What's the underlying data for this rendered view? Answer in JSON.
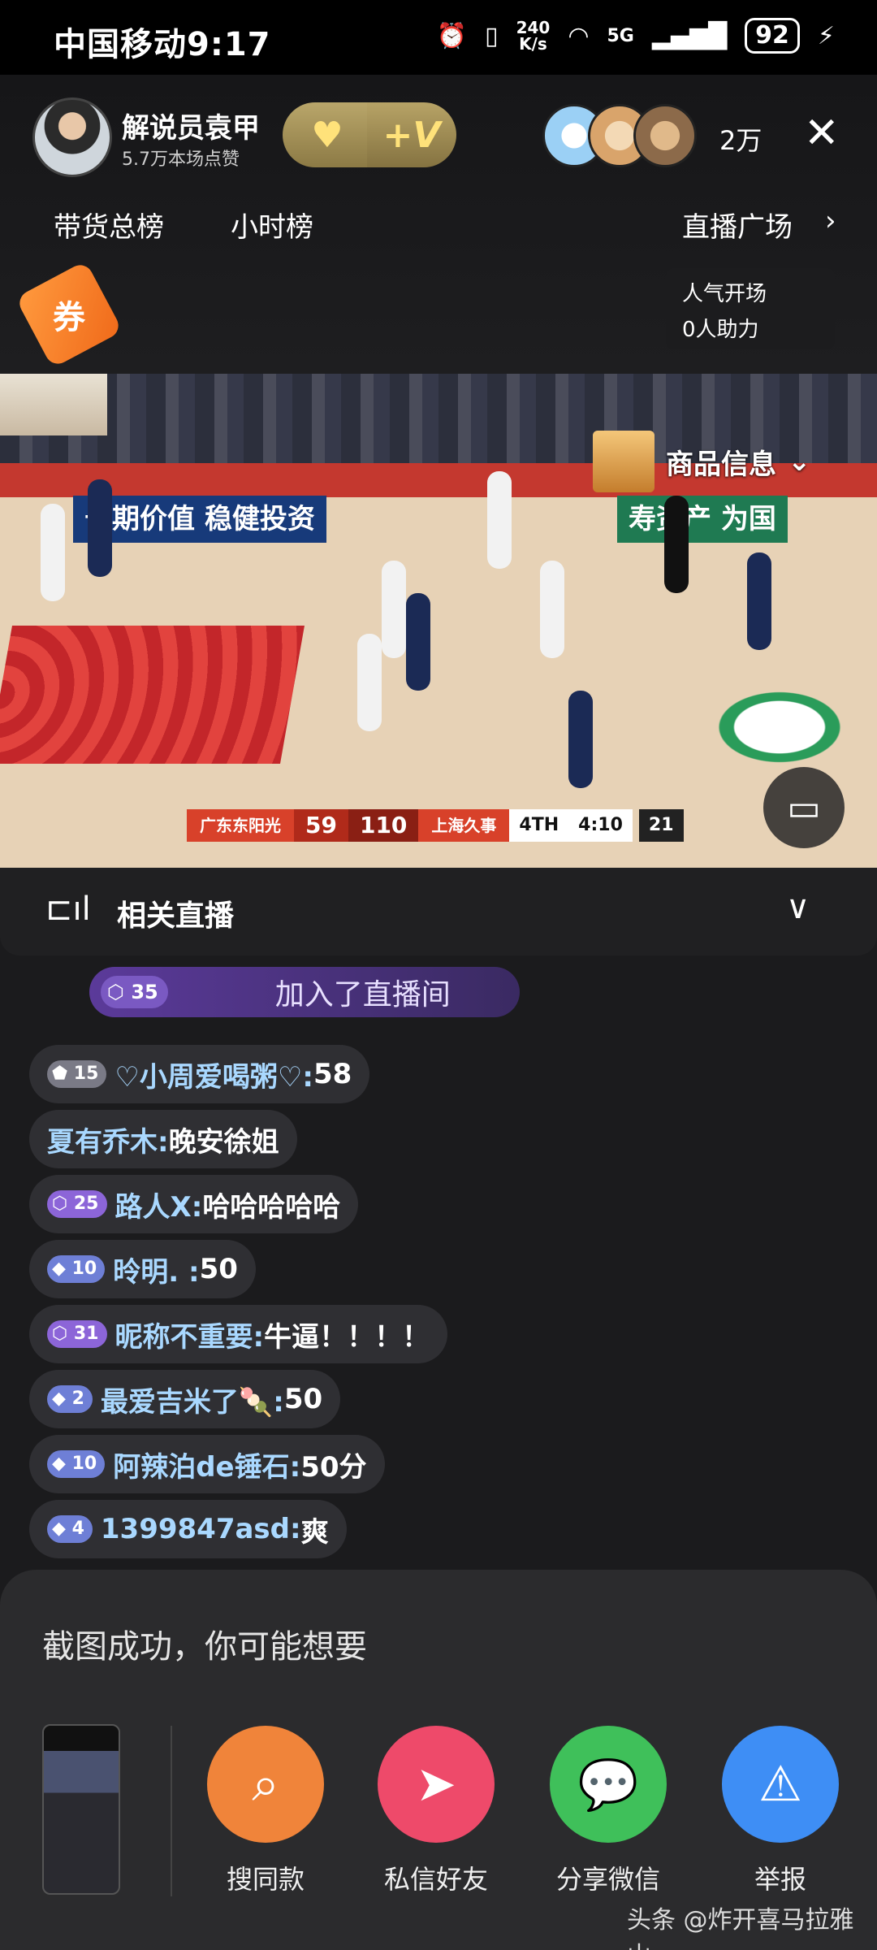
{
  "status": {
    "carrier_time": "中国移动9:17",
    "net_speed_value": "240",
    "net_speed_unit": "K/s",
    "signal": "5G",
    "battery": "92"
  },
  "anchor": {
    "name": "解说员袁甲",
    "likes": "5.7万本场点赞",
    "viewer_count": "2万"
  },
  "tabs": {
    "sales_rank": "带货总榜",
    "hour_rank": "小时榜",
    "plaza": "直播广场"
  },
  "popular": {
    "line1": "人气开场",
    "line2": "0人助力"
  },
  "coupon_label": "券",
  "video": {
    "ad_left": "长期价值 稳健投资",
    "ad_right": "寿资产 为国",
    "goods_label": "商品信息",
    "score": {
      "home": "广东东阳光",
      "home_score": "59",
      "away_score": "110",
      "away": "上海久事",
      "period": "4TH",
      "clock": "4:10",
      "shot_clock": "21"
    }
  },
  "related": {
    "title": "相关直播"
  },
  "chat": {
    "join": {
      "level": "35",
      "text": "加入了直播间"
    },
    "messages": [
      {
        "level": "15",
        "nick": "♡小周爱喝粥♡:",
        "text": "58"
      },
      {
        "level": "",
        "nick": "夏有乔木:",
        "text": "晚安徐姐"
      },
      {
        "level": "25",
        "nick": "路人X:",
        "text": "哈哈哈哈哈"
      },
      {
        "level": "10",
        "nick": "昤明. :",
        "text": "50"
      },
      {
        "level": "31",
        "nick": "昵称不重要:",
        "text": "牛逼！！！！"
      },
      {
        "level": "2",
        "nick": "最爱吉米了🍡:",
        "text": "50"
      },
      {
        "level": "10",
        "nick": "阿辣泊de锤石:",
        "text": "50分"
      },
      {
        "level": "4",
        "nick": "1399847asd:",
        "text": "爽"
      }
    ]
  },
  "sheet": {
    "title": "截图成功，你可能想要",
    "actions": [
      {
        "label": "搜同款",
        "color": "#f0843a",
        "icon": "scan-search-icon"
      },
      {
        "label": "私信好友",
        "color": "#ee4a6a",
        "icon": "send-icon"
      },
      {
        "label": "分享微信",
        "color": "#3fc05a",
        "icon": "wechat-icon"
      },
      {
        "label": "举报",
        "color": "#3e8ef5",
        "icon": "warning-icon"
      }
    ]
  },
  "watermark": "头条 @炸开喜马拉雅山"
}
